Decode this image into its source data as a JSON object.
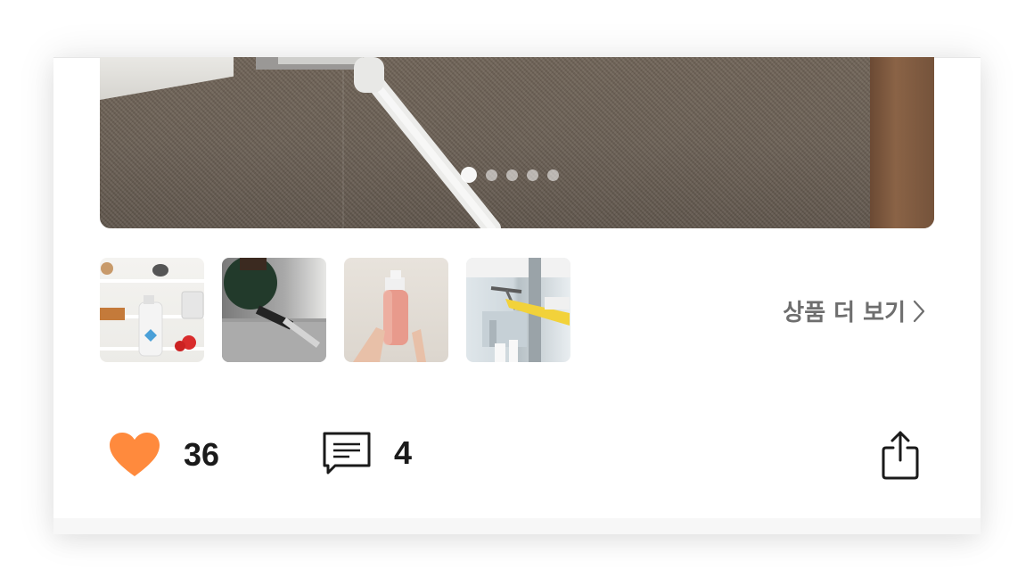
{
  "carousel": {
    "slide_count": 5,
    "active_index": 0
  },
  "thumbnails": [
    {
      "name": "thumbnail-shelf-cleaner"
    },
    {
      "name": "thumbnail-sofa-vacuum"
    },
    {
      "name": "thumbnail-spray-bottle"
    },
    {
      "name": "thumbnail-window-wiper"
    }
  ],
  "more_products": {
    "label": "상품 더 보기",
    "icon": "chevron-right-icon"
  },
  "actions": {
    "like_count": "36",
    "like_icon": "heart-icon",
    "like_color": "#ff8a3d",
    "comment_count": "4",
    "comment_icon": "comment-icon",
    "share_icon": "share-icon"
  }
}
